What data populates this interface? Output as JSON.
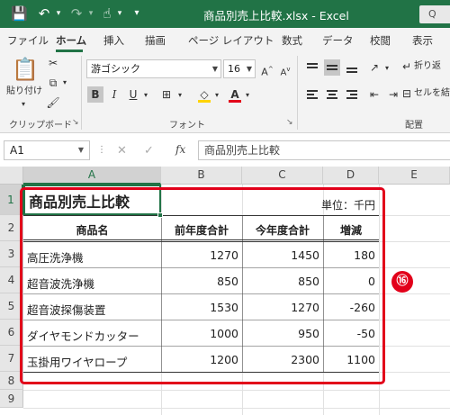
{
  "titlebar": {
    "title": "商品別売上比較.xlsx - Excel",
    "search_placeholder": "Q",
    "save_icon": "💾",
    "undo_icon": "↶",
    "redo_icon": "↷",
    "touch_icon": "☝",
    "qat_more_icon": "▾"
  },
  "ribbon_tabs": [
    "ファイル",
    "ホーム",
    "挿入",
    "描画",
    "ページ レイアウト",
    "数式",
    "データ",
    "校閲",
    "表示"
  ],
  "ribbon": {
    "clipboard": {
      "paste_label": "貼り付け",
      "group_label": "クリップボード"
    },
    "font": {
      "font_name": "游ゴシック",
      "font_size": "16",
      "bold": "B",
      "italic": "I",
      "underline": "U",
      "group_label": "フォント"
    },
    "alignment": {
      "wrap_label": "折り返",
      "merge_label": "セルを結",
      "group_label": "配置"
    }
  },
  "formula_bar": {
    "name_box": "A1",
    "cancel": "✕",
    "enter": "✓",
    "fx": "fx",
    "content": "商品別売上比較"
  },
  "sheet": {
    "columns": [
      "A",
      "B",
      "C",
      "D",
      "E"
    ],
    "rows": [
      "1",
      "2",
      "3",
      "4",
      "5",
      "6",
      "7",
      "8",
      "9"
    ],
    "title": "商品別売上比較",
    "unit": "単位：千円",
    "headers": [
      "商品名",
      "前年度合計",
      "今年度合計",
      "増減"
    ],
    "data": [
      [
        "高圧洗浄機",
        "1270",
        "1450",
        "180"
      ],
      [
        "超音波洗浄機",
        "850",
        "850",
        "0"
      ],
      [
        "超音波探傷装置",
        "1530",
        "1270",
        "-260"
      ],
      [
        "ダイヤモンドカッター",
        "1000",
        "950",
        "-50"
      ],
      [
        "玉掛用ワイヤロープ",
        "1200",
        "2300",
        "1100"
      ]
    ]
  },
  "annotation": {
    "badge": "⑯",
    "highlight_color": "#e2001a"
  },
  "colors": {
    "excel_green": "#217346"
  }
}
